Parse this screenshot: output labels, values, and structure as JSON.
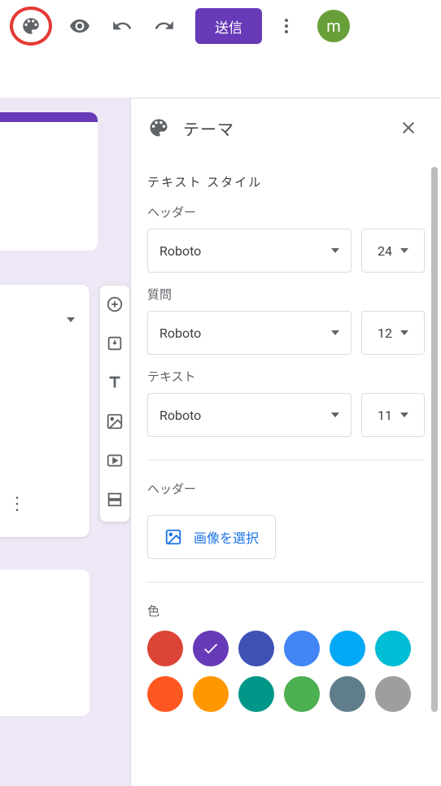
{
  "toolbar": {
    "send_label": "送信",
    "avatar_initial": "m"
  },
  "panel": {
    "title": "テーマ",
    "text_style_section": "テキスト スタイル",
    "header_label": "ヘッダー",
    "question_label": "質問",
    "text_label": "テキスト",
    "header_font": "Roboto",
    "header_size": "24",
    "question_font": "Roboto",
    "question_size": "12",
    "text_font": "Roboto",
    "text_size": "11",
    "header_image_section": "ヘッダー",
    "choose_image_label": "画像を選択",
    "color_section": "色",
    "colors": {
      "row1": [
        "#db4437",
        "#673ab7",
        "#3f51b5",
        "#4285f4",
        "#03a9f4",
        "#00bcd4"
      ],
      "row2": [
        "#ff5722",
        "#ff9800",
        "#009688",
        "#4caf50",
        "#607d8b",
        "#9e9e9e"
      ],
      "selected_index": 1
    }
  }
}
